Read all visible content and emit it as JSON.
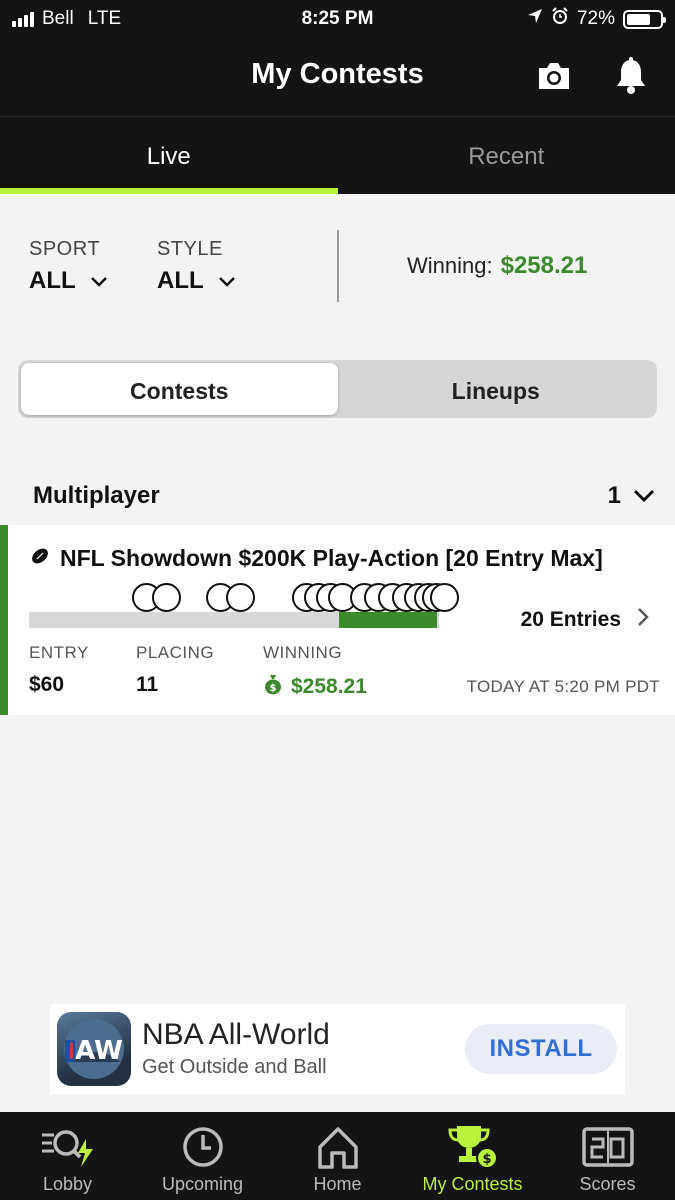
{
  "status_bar": {
    "carrier": "Bell",
    "network": "LTE",
    "time": "8:25 PM",
    "battery": "72%",
    "battery_level": 0.72
  },
  "header": {
    "title": "My Contests",
    "icons": [
      "camera-icon",
      "bell-icon"
    ]
  },
  "tabs": [
    {
      "label": "Live",
      "active": true
    },
    {
      "label": "Recent",
      "active": false
    }
  ],
  "filters": {
    "sport": {
      "label": "SPORT",
      "value": "ALL"
    },
    "style": {
      "label": "STYLE",
      "value": "ALL"
    },
    "winning_label": "Winning:",
    "winning_amount": "$258.21"
  },
  "segmented": {
    "contests": "Contests",
    "lineups": "Lineups",
    "active": "contests"
  },
  "section": {
    "title": "Multiplayer",
    "count": "1"
  },
  "contest": {
    "title": "NFL Showdown $200K Play-Action [20 Entry Max]",
    "entries_label": "20 Entries",
    "entry_label": "ENTRY",
    "entry_value": "$60",
    "placing_label": "PLACING",
    "placing_value": "11",
    "winning_label": "WINNING",
    "winning_value": "$258.21",
    "date": "TODAY AT 5:20 PM PDT"
  },
  "ad": {
    "title": "NBA All-World",
    "subtitle": "Get Outside and Ball",
    "button": "INSTALL"
  },
  "bottom_nav": [
    {
      "label": "Lobby",
      "icon": "lobby-search-icon"
    },
    {
      "label": "Upcoming",
      "icon": "clock-icon"
    },
    {
      "label": "Home",
      "icon": "home-icon"
    },
    {
      "label": "My Contests",
      "icon": "trophy-icon",
      "active": true
    },
    {
      "label": "Scores",
      "icon": "scoreboard-icon"
    }
  ],
  "colors": {
    "accent": "#b8f23b",
    "green": "#3b8a2b",
    "dark": "#141414",
    "link_blue": "#2f6fd6"
  }
}
